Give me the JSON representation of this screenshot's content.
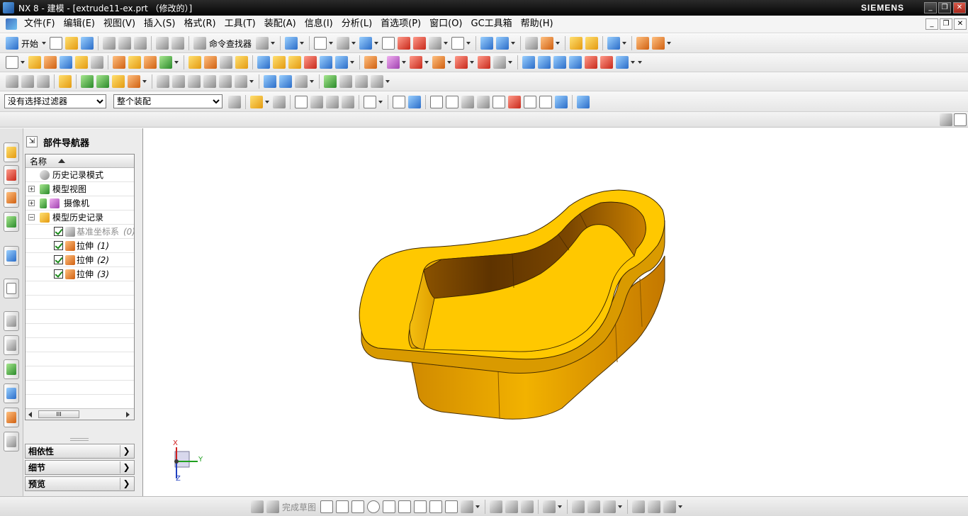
{
  "titlebar": {
    "title": "NX 8 - 建模 - [extrude11-ex.prt （修改的）]",
    "brand": "SIEMENS",
    "minimize": "_",
    "restore": "❐",
    "close": "✕"
  },
  "menubar": {
    "items": [
      "文件(F)",
      "编辑(E)",
      "视图(V)",
      "插入(S)",
      "格式(R)",
      "工具(T)",
      "装配(A)",
      "信息(I)",
      "分析(L)",
      "首选项(P)",
      "窗口(O)",
      "GC工具箱",
      "帮助(H)"
    ],
    "doc_minimize": "_",
    "doc_restore": "❐",
    "doc_close": "✕"
  },
  "toolbar_standard": {
    "start_label": "开始",
    "command_finder_label": "命令查找器"
  },
  "selection_bar": {
    "filter_value": "没有选择过滤器",
    "scope_value": "整个装配"
  },
  "navigator": {
    "title": "部件导航器",
    "pin_glyph": "⇲",
    "column_name": "名称",
    "rows": [
      {
        "label": "历史记录模式",
        "suffix": ""
      },
      {
        "label": "模型视图",
        "suffix": ""
      },
      {
        "label": "摄像机",
        "suffix": ""
      },
      {
        "label": "模型历史记录",
        "suffix": ""
      },
      {
        "label": "基准坐标系",
        "suffix": "(0)"
      },
      {
        "label": "拉伸",
        "suffix": "(1)"
      },
      {
        "label": "拉伸",
        "suffix": "(2)"
      },
      {
        "label": "拉伸",
        "suffix": "(3)"
      }
    ],
    "expand_plus": "+",
    "expand_minus": "−",
    "scroll_thumb": "III",
    "sections": [
      "相依性",
      "细节",
      "预览"
    ],
    "section_chevron": "❯"
  },
  "triad": {
    "x": "X",
    "y": "Y",
    "z": "Z"
  },
  "sketchbar": {
    "finish_sketch_label": "完成草图"
  },
  "colors": {
    "part_top": "#FFC800",
    "part_wall_light": "#E8A400",
    "part_wall_dark": "#6E3E00",
    "accent_blue": "#2A6CC8"
  }
}
